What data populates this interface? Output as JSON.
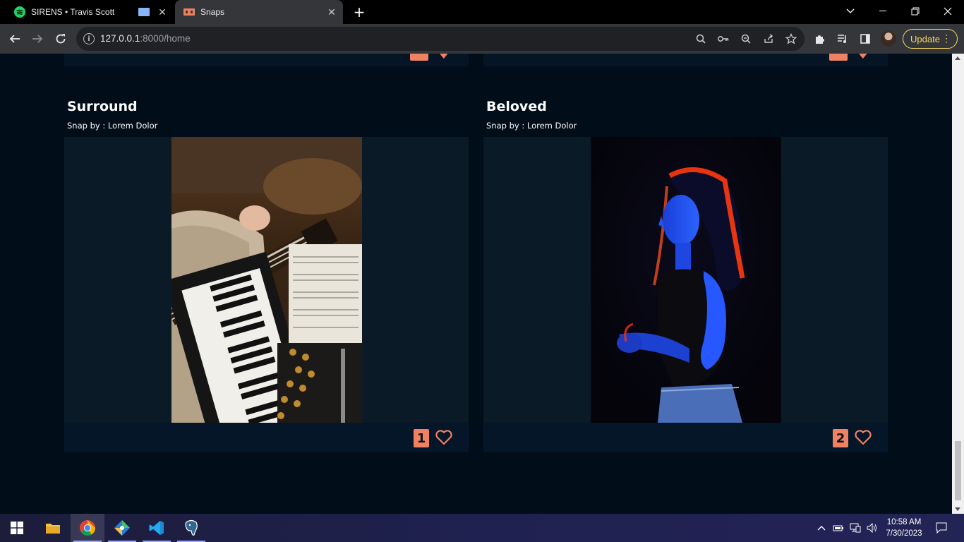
{
  "browser": {
    "tabs": [
      {
        "title": "SIRENS • Travis Scott",
        "favicon": "spotify-icon",
        "active": false
      },
      {
        "title": "Snaps",
        "favicon": "snaps-icon",
        "active": true
      }
    ],
    "url": {
      "host": "127.0.0.1",
      "rest": ":8000/home"
    },
    "update_label": "Update"
  },
  "posts": [
    {
      "title": "Surround",
      "by": "Snap by : Lorem Dolor",
      "likes": "1",
      "image": "guitar-piano-photo"
    },
    {
      "title": "Beloved",
      "by": "Snap by : Lorem Dolor",
      "likes": "2",
      "image": "woman-neon-portrait-photo"
    }
  ],
  "colors": {
    "page_bg": "#010d19",
    "card_bg": "#0a1a26",
    "accent": "#f08262"
  },
  "taskbar": {
    "apps": [
      "windows-start",
      "file-explorer",
      "chrome",
      "git-kraken",
      "vscode",
      "pgadmin"
    ],
    "time": "10:58 AM",
    "date": "7/30/2023"
  }
}
